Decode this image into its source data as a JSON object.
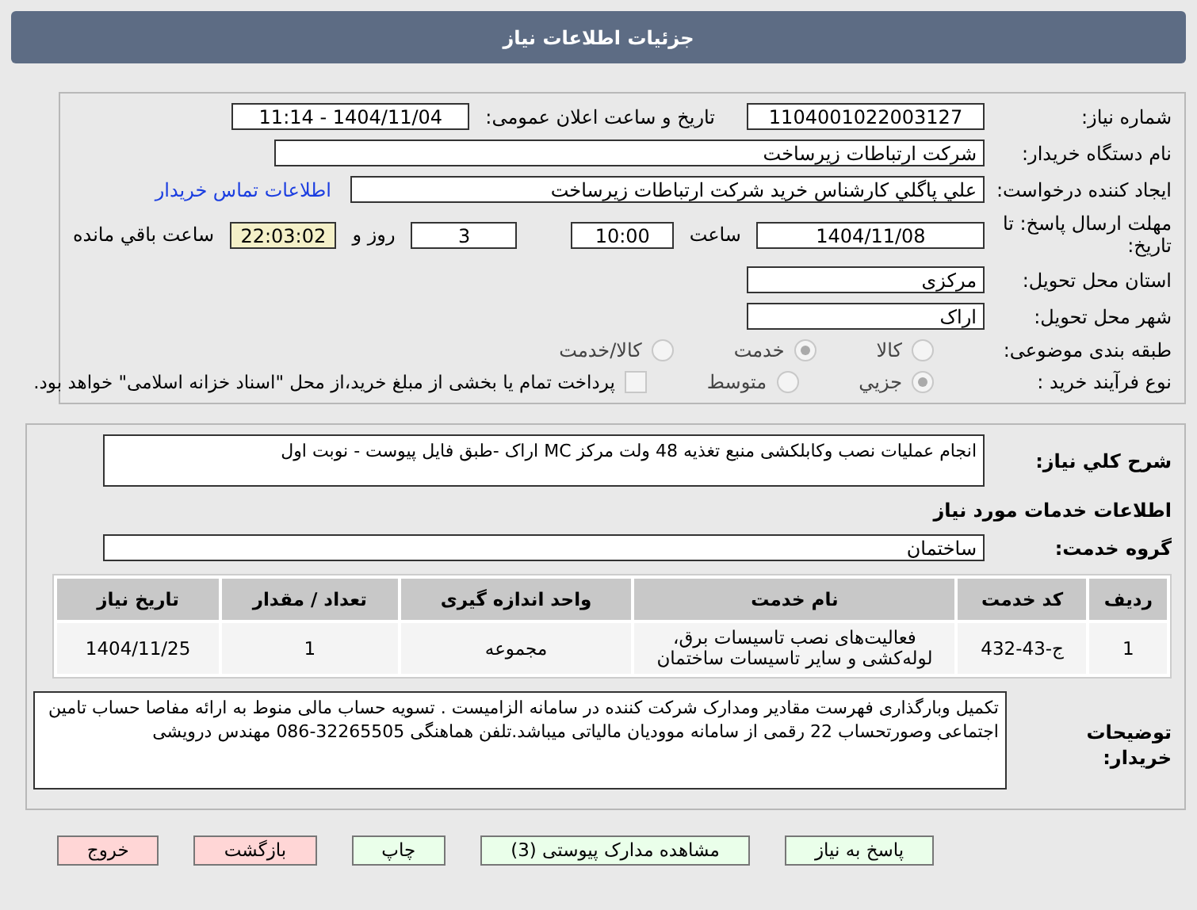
{
  "header": {
    "title": "جزئیات اطلاعات نیاز"
  },
  "need": {
    "number_label": "شماره نیاز:",
    "number": "1104001022003127",
    "announce_label": "تاریخ و ساعت اعلان عمومی:",
    "announce": "1404/11/04 - 11:14",
    "buyer_label": "نام دستگاه خریدار:",
    "buyer": "شرکت ارتباطات زیرساخت",
    "requester_label": "ایجاد کننده درخواست:",
    "requester": "علي پاگلي کارشناس خرید شرکت ارتباطات زیرساخت",
    "contact_link": "اطلاعات تماس خریدار",
    "deadline_label": "مهلت ارسال پاسخ: تا تاریخ:",
    "deadline_date": "1404/11/08",
    "time_label": "ساعت",
    "time": "10:00",
    "days": "3",
    "days_label": "روز و",
    "remaining": "22:03:02",
    "remaining_label": "ساعت باقي مانده",
    "province_label": "استان محل تحویل:",
    "province": "مرکزی",
    "city_label": "شهر محل تحویل:",
    "city": "اراک"
  },
  "category": {
    "label": "طبقه بندی موضوعی:",
    "options": [
      {
        "label": "کالا",
        "selected": false
      },
      {
        "label": "خدمت",
        "selected": true
      },
      {
        "label": "کالا/خدمت",
        "selected": false
      }
    ]
  },
  "process": {
    "label": "نوع فرآیند خرید :",
    "options": [
      {
        "label": "جزیي",
        "selected": true
      },
      {
        "label": "متوسط",
        "selected": false
      }
    ],
    "treasury": {
      "checked": false,
      "label": "پرداخت تمام یا بخشی از مبلغ خرید،از محل \"اسناد خزانه اسلامی\" خواهد بود."
    }
  },
  "summary": {
    "label": "شرح کلي نیاز:",
    "text": "انجام عملیات نصب وکابلکشی منبع تغذیه 48 ولت مرکز MC اراک -طبق فایل پیوست - نوبت اول"
  },
  "services": {
    "title": "اطلاعات خدمات مورد نیاز",
    "group_label": "گروه خدمت:",
    "group": "ساختمان",
    "columns": [
      "ردیف",
      "کد خدمت",
      "نام خدمت",
      "واحد اندازه گیری",
      "تعداد / مقدار",
      "تاریخ نیاز"
    ],
    "rows": [
      [
        "1",
        "ج-43-432",
        "فعالیت‌های نصب تاسیسات برق، لوله‌کشی و سایر تاسیسات ساختمان",
        "مجموعه",
        "1",
        "1404/11/25"
      ]
    ]
  },
  "notes": {
    "label": "توضیحات خریدار:",
    "text": "تکمیل وبارگذاری فهرست مقادیر ومدارک شرکت کننده در سامانه الزامیست . تسویه حساب مالی منوط به ارائه مفاصا حساب تامین اجتماعی وصورتحساب 22 رقمی از سامانه موودیان مالیاتی میباشد.تلفن هماهنگی 32265505-086 مهندس درویشی"
  },
  "buttons": [
    {
      "label": "پاسخ به نیاز",
      "color": "#eaffea"
    },
    {
      "label": "مشاهده مدارک پیوستی (3)",
      "color": "#eaffea"
    },
    {
      "label": "چاپ",
      "color": "#eaffea"
    },
    {
      "label": "بازگشت",
      "color": "#ffd6d6"
    },
    {
      "label": "خروج",
      "color": "#ffd6d6"
    }
  ]
}
